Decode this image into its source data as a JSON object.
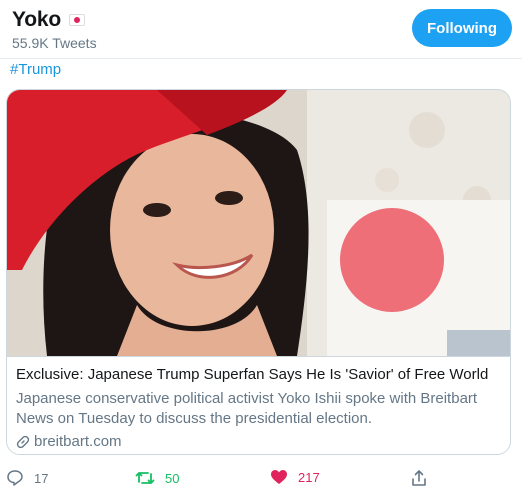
{
  "header": {
    "display_name": "Yoko",
    "flag_icon": "japan-flag-icon",
    "tweet_count": "55.9K Tweets",
    "follow_button": "Following",
    "accent_color": "#1da1f2"
  },
  "tweet": {
    "hashtag": "#Trump"
  },
  "card": {
    "image_description_icon": "photo-woman-red-cap-japanese-flag",
    "title": "Exclusive: Japanese Trump Superfan Says He Is 'Savior' of Free World",
    "description": "Japanese conservative political activist Yoko Ishii spoke with Breitbart News on Tuesday to discuss the presidential election.",
    "domain": "breitbart.com"
  },
  "actions": {
    "reply_count": "17",
    "retweet_count": "50",
    "like_count": "217",
    "retweet_color": "#17bf63",
    "like_color": "#e0245e"
  }
}
